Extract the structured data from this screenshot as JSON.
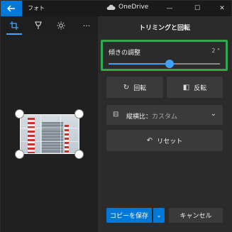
{
  "app": {
    "name": "フォト",
    "onedrive_label": "OneDrive"
  },
  "window_controls": {
    "minimize": "—",
    "maximize": "☐",
    "close": "✕"
  },
  "toolbar": {
    "more": "···"
  },
  "panel": {
    "title": "トリミングと回転",
    "straighten": {
      "label": "傾きの調整",
      "value": "2 °",
      "level": 0.55
    },
    "rotate_label": "回転",
    "flip_label": "反転",
    "aspect": {
      "label": "縦横比：",
      "value": "カスタム"
    },
    "reset_label": "リセット",
    "save_copy_label": "コピーを保存",
    "cancel_label": "キャンセル"
  },
  "colors": {
    "accent": "#0078d7",
    "highlight_box": "#2fa84f",
    "slider": "#3fa0ff"
  }
}
